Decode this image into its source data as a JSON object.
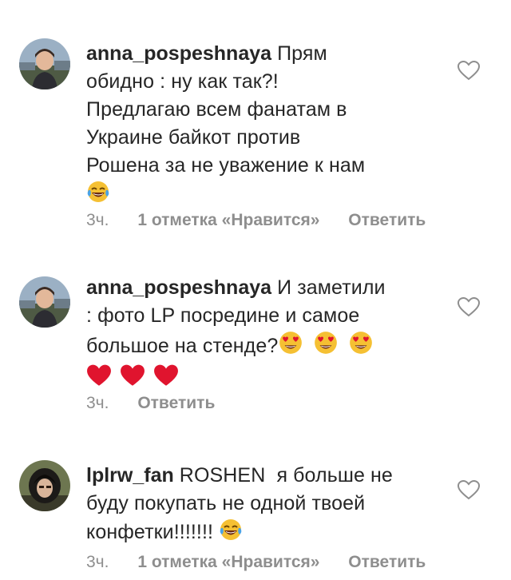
{
  "comments": [
    {
      "username": "anna_pospeshnaya",
      "lines": [
        "Прям",
        "обидно : ну как так?!",
        "Предлагаю всем фанатам в",
        "Украине байкот против",
        "Рошена за не уважение к нам"
      ],
      "emojis": [
        "face-with-tears-of-joy-emoji"
      ],
      "time": "3ч.",
      "likes": "1 отметка «Нравится»",
      "reply": "Ответить"
    },
    {
      "username": "anna_pospeshnaya",
      "lines": [
        "И заметили",
        ": фото LP посредине и самое",
        "большое на стенде?"
      ],
      "emojis": [
        "heart-eyes-emoji",
        "heart-eyes-emoji",
        "heart-eyes-emoji",
        "red-heart-emoji",
        "red-heart-emoji",
        "red-heart-emoji"
      ],
      "time": "3ч.",
      "reply": "Ответить"
    },
    {
      "username": "lplrw_fan",
      "lines": [
        "ROSHEN  я больше не",
        "буду покупать не одной твоей",
        "конфетки!!!!!!!"
      ],
      "emojis": [
        "face-with-tears-of-joy-emoji"
      ],
      "time": "3ч.",
      "likes": "1 отметка «Нравится»",
      "reply": "Ответить"
    }
  ],
  "colors": {
    "text": "#262626",
    "secondary": "#8e8e8e",
    "heart_red": "#e0142e",
    "emoji_yellow": "#f5c033"
  }
}
